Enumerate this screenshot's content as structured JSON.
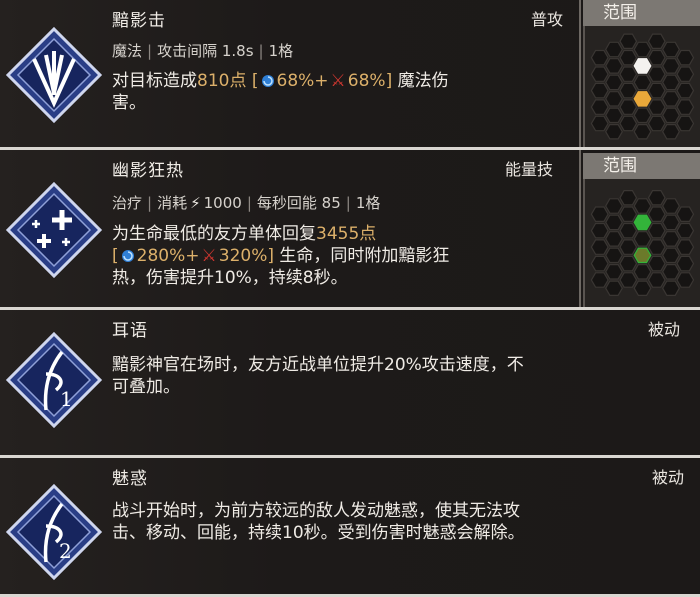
{
  "colors": {
    "gold": "#dcb06a",
    "highlight_white": "#f4f2ef",
    "highlight_orange": "#e9a83a",
    "highlight_green": "#33b43a",
    "cross_red": "#c9362f"
  },
  "skills": [
    {
      "name": "黯影击",
      "type": "普攻",
      "icon": "triple-arrow-down-icon",
      "meta": [
        "魔法",
        "攻击间隔 1.8s",
        "1格"
      ],
      "desc": {
        "l1a": "对目标造成",
        "l1b": "810点",
        "l1c": "[",
        "pct1": "68%+",
        "pct2": "68%]",
        "l1d": "魔法伤",
        "l2": "害。"
      },
      "range_label": "范围"
    },
    {
      "name": "幽影狂热",
      "type": "能量技",
      "icon": "sparkle-plus-icon",
      "meta": {
        "a": "治疗",
        "b": "消耗",
        "c": "1000",
        "d": "每秒回能 85",
        "e": "1格"
      },
      "desc": {
        "l1a": "为生命最低的友方单体回复",
        "l1b": "3455点",
        "l2a": "[",
        "pct1": "280%+",
        "pct2": "320%]",
        "l2b": "生命，同时附加黯影狂",
        "l3": "热，伤害提升10%，持续8秒。"
      },
      "range_label": "范围"
    },
    {
      "name": "耳语",
      "type": "被动",
      "icon": "feather-rune-1-icon",
      "desc": {
        "l1": "黯影神官在场时，友方近战单位提升20%攻击速度，不",
        "l2": "可叠加。"
      }
    },
    {
      "name": "魅惑",
      "type": "被动",
      "icon": "feather-rune-2-icon",
      "desc": {
        "l1": "战斗开始时，为前方较远的敌人发动魅惑，使其无法攻",
        "l2": "击、移动、回能，持续10秒。受到伤害时魅惑会解除。"
      }
    }
  ]
}
